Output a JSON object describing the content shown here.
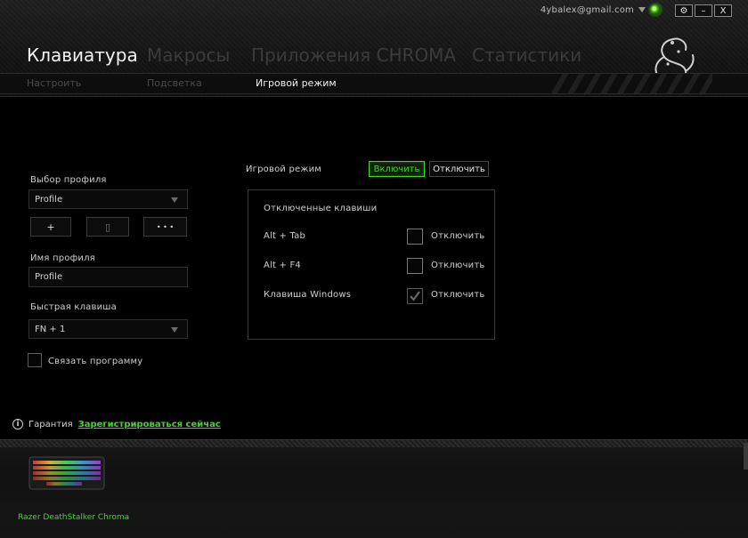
{
  "account": {
    "email": "4ybalex@gmail.com"
  },
  "window_controls": {
    "settings": "⚙",
    "minimize": "–",
    "close": "X"
  },
  "main_tabs": [
    "Клавиатура",
    "Макросы",
    "Приложения CHROMA",
    "Статистики"
  ],
  "sub_tabs": [
    "Настроить",
    "Подсветка",
    "Игровой режим"
  ],
  "active_main_tab": "Клавиатура",
  "active_sub_tab": "Игровой режим",
  "profile_panel": {
    "profile_select_label": "Выбор профиля",
    "profile_select_value": "Profile",
    "add_button": "+",
    "delete_button": "▯",
    "more_button": "• • •",
    "profile_name_label": "Имя профиля",
    "profile_name_value": "Profile",
    "hotkey_label": "Быстрая клавиша",
    "hotkey_value": "FN + 1",
    "link_program_label": "Связать программу"
  },
  "game_mode": {
    "label": "Игровой режим",
    "enable_label": "Включить",
    "disable_label": "Отключить",
    "disabled_keys_title": "Отключенные клавиши",
    "keys": [
      {
        "name": "Alt + Tab",
        "action": "Отключить",
        "checked": false
      },
      {
        "name": "Alt + F4",
        "action": "Отключить",
        "checked": false
      },
      {
        "name": "Клавиша Windows",
        "action": "Отключить",
        "checked": true
      }
    ]
  },
  "footer": {
    "warranty_label": "Гарантия",
    "register_link": "Зарегистрироваться сейчас",
    "device_name": "Razer DeathStalker Chroma"
  },
  "colors": {
    "accent": "#44d62c",
    "background": "#000000",
    "inactive_tab": "#3b3b3b"
  },
  "icons": {
    "settings": "gear-icon",
    "status": "status-indicator-icon",
    "info": "info-icon",
    "logo": "razer-snake-logo",
    "check": "checkmark-icon"
  }
}
